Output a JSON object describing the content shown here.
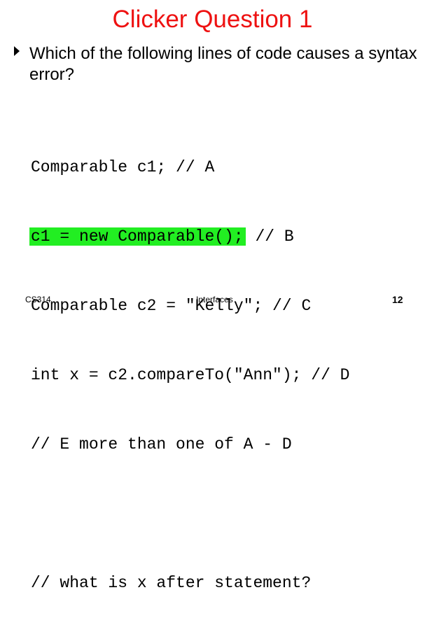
{
  "slide": {
    "title": "Clicker Question 1",
    "bullet_text": "Which of the following lines of code causes a syntax error?",
    "code_lines": [
      "Comparable c1; // A",
      "c1 = new Comparable();",
      " // B",
      "Comparable c2 = \"Kelly\"; // C",
      "int x = c2.compareTo(\"Ann\"); // D",
      "// E more than one of A - D",
      "// what is x after statement?"
    ],
    "highlight_color": "#22ee22",
    "title_color": "#ee1111"
  },
  "footer": {
    "course": "CS314",
    "topic": "Interfaces",
    "page_number": "12"
  }
}
